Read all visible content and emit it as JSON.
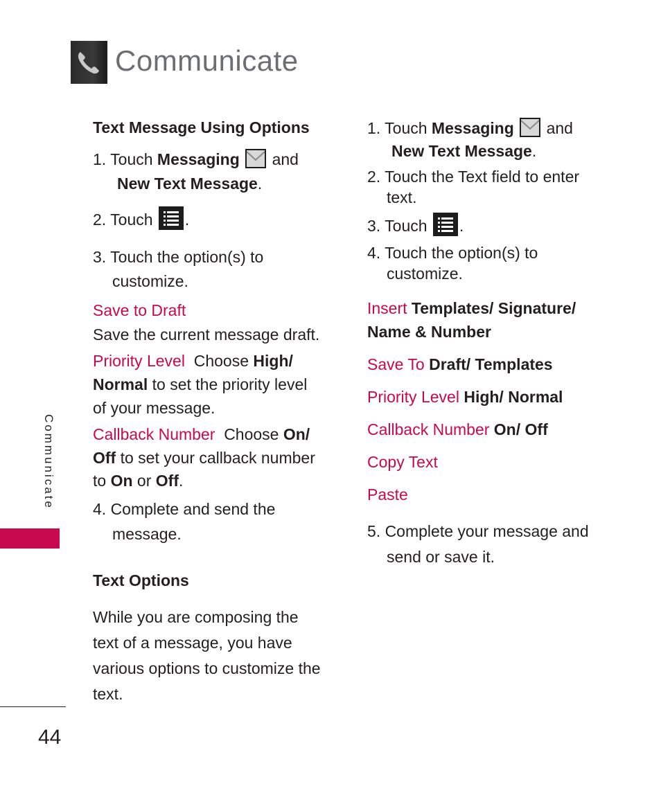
{
  "header": {
    "title": "Communicate",
    "icon": "phone-handset-icon"
  },
  "side_tab": {
    "label": "Communicate",
    "accent_color": "#c8084f"
  },
  "footer": {
    "page_number": "44"
  },
  "colors": {
    "accent": "#c8084f",
    "text": "#231f20",
    "title": "#6d6e71"
  },
  "left": {
    "section1_heading": "Text Message Using Options",
    "s1": {
      "num": "1. Touch ",
      "bold": "Messaging",
      "after": "and",
      "line2": "New Text Message",
      "line2_end": "."
    },
    "s2": {
      "num": "2. Touch ",
      "end": "."
    },
    "s3": {
      "line1": "3. Touch the option(s) to",
      "line2": "customize."
    },
    "opt_save": {
      "label": "Save to Draft",
      "desc": "Save the current message draft."
    },
    "opt_priority": {
      "label": "Priority Level",
      "t1": "Choose ",
      "b1": "High/",
      "b2": "Normal",
      "t2": " to set the priority level",
      "t3": "of your message."
    },
    "opt_callback": {
      "label": "Callback Number",
      "t1": "Choose ",
      "b1": "On/",
      "b2": "Off",
      "t2": " to set your callback number",
      "t3": "to ",
      "b3": "On",
      "t4": " or ",
      "b4": "Off",
      "t5": "."
    },
    "s4": {
      "line1": "4. Complete and send the",
      "line2": "message."
    },
    "section2_heading": "Text Options",
    "para": [
      "While you are composing the",
      "text of a message, you have",
      "various options to customize the",
      "text."
    ]
  },
  "right": {
    "s1": {
      "num": "1. Touch ",
      "bold": "Messaging",
      "after": "and",
      "line2": "New Text Message",
      "line2_end": "."
    },
    "s2": {
      "line1": "2. Touch the Text field to enter",
      "line2": "text."
    },
    "s3": {
      "num": "3. Touch ",
      "end": "."
    },
    "s4": {
      "line1": "4. Touch the option(s) to",
      "line2": "customize."
    },
    "options": [
      {
        "label": "Insert",
        "value": "Templates/ Signature/",
        "value2": "Name & Number"
      },
      {
        "label": "Save To",
        "value": "Draft/ Templates"
      },
      {
        "label": "Priority Level",
        "value": "High/ Normal"
      },
      {
        "label": "Callback Number",
        "value": "On/ Off"
      },
      {
        "label": "Copy Text",
        "value": ""
      },
      {
        "label": "Paste",
        "value": ""
      }
    ],
    "s5": {
      "line1": "5. Complete your message and",
      "line2": "send or save it."
    }
  }
}
